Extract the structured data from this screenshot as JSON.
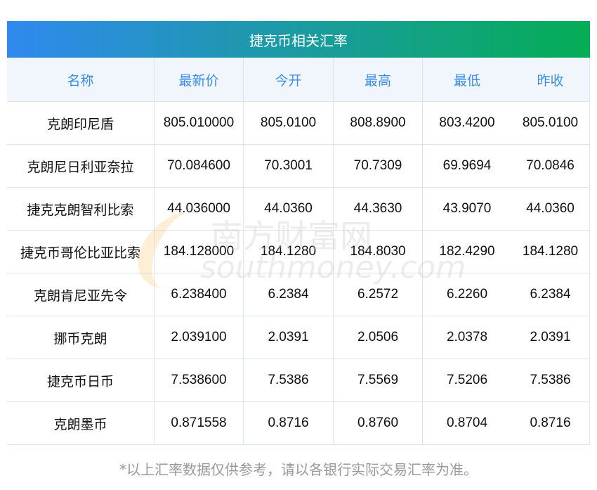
{
  "title": "捷克币相关汇率",
  "columns": [
    "名称",
    "最新价",
    "今开",
    "最高",
    "最低",
    "昨收"
  ],
  "rows": [
    [
      "克朗印尼盾",
      "805.010000",
      "805.0100",
      "808.8900",
      "803.4200",
      "805.0100"
    ],
    [
      "克朗尼日利亚奈拉",
      "70.084600",
      "70.3001",
      "70.7309",
      "69.9694",
      "70.0846"
    ],
    [
      "捷克克朗智利比索",
      "44.036000",
      "44.0360",
      "44.3630",
      "43.9070",
      "44.0360"
    ],
    [
      "捷克币哥伦比亚比索",
      "184.128000",
      "184.1280",
      "184.8030",
      "182.4290",
      "184.1280"
    ],
    [
      "克朗肯尼亚先令",
      "6.238400",
      "6.2384",
      "6.2572",
      "6.2260",
      "6.2384"
    ],
    [
      "挪币克朗",
      "2.039100",
      "2.0391",
      "2.0506",
      "2.0378",
      "2.0391"
    ],
    [
      "捷克币日币",
      "7.538600",
      "7.5386",
      "7.5569",
      "7.5206",
      "7.5386"
    ],
    [
      "克朗墨币",
      "0.871558",
      "0.8716",
      "0.8760",
      "0.8704",
      "0.8716"
    ]
  ],
  "note": "*以上汇率数据仅供参考，请以各银行实际交易汇率为准。",
  "watermark": {
    "cn": "南方财富网",
    "en": "southmoney.com"
  }
}
